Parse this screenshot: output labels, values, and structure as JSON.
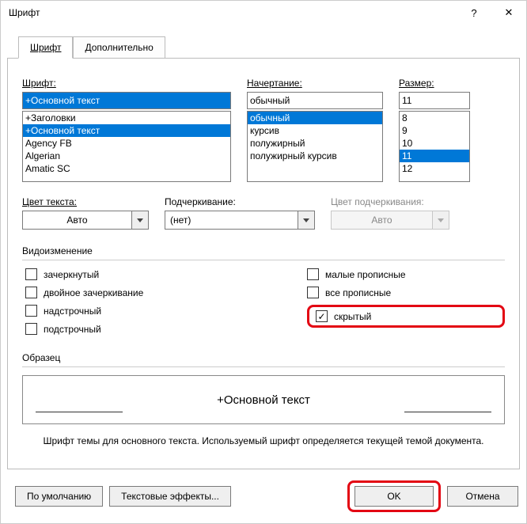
{
  "window": {
    "title": "Шрифт",
    "help_symbol": "?",
    "close_symbol": "✕"
  },
  "tabs": {
    "font": "Шрифт",
    "advanced": "Дополнительно"
  },
  "labels": {
    "font": "Шрифт:",
    "style": "Начертание:",
    "size": "Размер:",
    "text_color": "Цвет текста:",
    "underline": "Подчеркивание:",
    "underline_color": "Цвет подчеркивания:",
    "effects_section": "Видоизменение",
    "preview_section": "Образец"
  },
  "font": {
    "value": "+Основной текст",
    "list": [
      "+Заголовки",
      "+Основной текст",
      "Agency FB",
      "Algerian",
      "Amatic SC"
    ],
    "selected_index": 1
  },
  "style": {
    "value": "обычный",
    "list": [
      "обычный",
      "курсив",
      "полужирный",
      "полужирный курсив"
    ],
    "selected_index": 0
  },
  "size": {
    "value": "11",
    "list": [
      "8",
      "9",
      "10",
      "11",
      "12"
    ],
    "selected_index": 3
  },
  "color": {
    "value": "Авто"
  },
  "underline": {
    "value": "(нет)"
  },
  "underline_color": {
    "value": "Авто"
  },
  "effects": {
    "strike": "зачеркнутый",
    "double_strike": "двойное зачеркивание",
    "superscript": "надстрочный",
    "subscript": "подстрочный",
    "smallcaps": "малые прописные",
    "allcaps": "все прописные",
    "hidden": "скрытый"
  },
  "preview": {
    "text": "+Основной текст"
  },
  "hint": "Шрифт темы для основного текста. Используемый шрифт определяется текущей темой документа.",
  "buttons": {
    "default": "По умолчанию",
    "text_effects": "Текстовые эффекты...",
    "ok": "OK",
    "cancel": "Отмена"
  }
}
